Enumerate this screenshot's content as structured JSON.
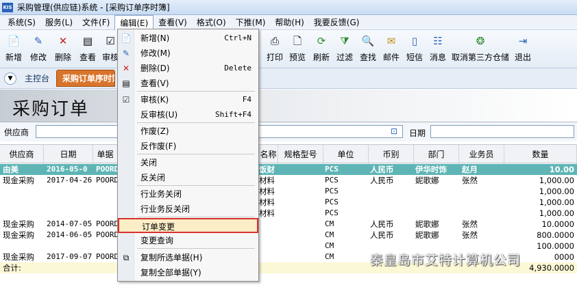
{
  "window": {
    "logo": "KIS",
    "title": "采购管理(供应链)系统 - [采购订单序时簿]"
  },
  "menu": [
    "系统(S)",
    "服务(L)",
    "文件(F)",
    "编辑(E)",
    "查看(V)",
    "格式(O)",
    "下推(M)",
    "帮助(H)",
    "我要反馈(G)"
  ],
  "toolbar": [
    {
      "label": "新增",
      "icon": "new-doc-icon"
    },
    {
      "label": "修改",
      "icon": "edit-icon"
    },
    {
      "label": "删除",
      "icon": "delete-icon"
    },
    {
      "label": "查看",
      "icon": "view-icon"
    },
    {
      "label": "审核",
      "icon": "audit-icon"
    },
    {
      "label": "打印",
      "icon": "print-icon"
    },
    {
      "label": "预览",
      "icon": "preview-icon"
    },
    {
      "label": "刷新",
      "icon": "refresh-icon"
    },
    {
      "label": "过滤",
      "icon": "filter-icon"
    },
    {
      "label": "查找",
      "icon": "find-icon"
    },
    {
      "label": "邮件",
      "icon": "mail-icon"
    },
    {
      "label": "短信",
      "icon": "sms-icon"
    },
    {
      "label": "消息",
      "icon": "message-icon"
    },
    {
      "label": "取消第三方仓储",
      "icon": "warehouse-icon"
    },
    {
      "label": "退出",
      "icon": "exit-icon"
    }
  ],
  "tabs": {
    "home": "主控台",
    "active": "采购订单序时簿"
  },
  "banner": {
    "title": "采购订单"
  },
  "filter": {
    "supplier_label": "供应商",
    "supplier_value": "",
    "date_label": "日期",
    "date_value": ""
  },
  "grid": {
    "headers": [
      "供应商",
      "日期",
      "单据",
      "名称",
      "规格型号",
      "单位",
      "币别",
      "部门",
      "业务员",
      "数量"
    ],
    "rows": [
      {
        "supplier": "由美",
        "date": "2016-05-0",
        "bill": "POORD",
        "name": "饭财",
        "unit": "PCS",
        "currency": "人民币",
        "dept": "伊华时饰",
        "clerk": "赵月",
        "qty": "10.00",
        "sel": true
      },
      {
        "supplier": "现金采购",
        "date": "2017-04-26",
        "bill": "POORD",
        "name": "材料",
        "unit": "PCS",
        "currency": "人民币",
        "dept": "妮歌娜",
        "clerk": "张然",
        "qty": "1,000.00"
      },
      {
        "supplier": "",
        "date": "",
        "bill": "",
        "name": "材料",
        "unit": "PCS",
        "currency": "",
        "dept": "",
        "clerk": "",
        "qty": "1,000.00"
      },
      {
        "supplier": "",
        "date": "",
        "bill": "",
        "name": "材料",
        "unit": "PCS",
        "currency": "",
        "dept": "",
        "clerk": "",
        "qty": "1,000.00"
      },
      {
        "supplier": "",
        "date": "",
        "bill": "",
        "name": "材料",
        "unit": "PCS",
        "currency": "",
        "dept": "",
        "clerk": "",
        "qty": "1,000.00"
      },
      {
        "supplier": "现金采购",
        "date": "2014-07-05",
        "bill": "POORD",
        "name": "",
        "unit": "CM",
        "currency": "人民币",
        "dept": "妮歌娜",
        "clerk": "张然",
        "qty": "10.0000"
      },
      {
        "supplier": "现金采购",
        "date": "2014-06-05",
        "bill": "POORD",
        "name": "",
        "unit": "CM",
        "currency": "人民币",
        "dept": "妮歌娜",
        "clerk": "张然",
        "qty": "800.0000"
      },
      {
        "supplier": "",
        "date": "",
        "bill": "",
        "name": "",
        "unit": "CM",
        "currency": "",
        "dept": "",
        "clerk": "",
        "qty": "100.0000"
      },
      {
        "supplier": "现金采购",
        "date": "2017-09-07",
        "bill": "POORD",
        "name": "",
        "unit": "CM",
        "currency": "",
        "dept": "",
        "clerk": "",
        "qty": "0000"
      }
    ],
    "total": {
      "label": "合计:",
      "qty": "4,930.0000"
    }
  },
  "edit_menu": [
    {
      "label": "新增(N)",
      "key": "Ctrl+N",
      "icon": "new-doc-icon"
    },
    {
      "label": "修改(M)",
      "key": "",
      "icon": "edit-icon"
    },
    {
      "label": "删除(D)",
      "key": "Delete",
      "icon": "delete-icon"
    },
    {
      "label": "查看(V)",
      "key": "",
      "icon": "view-icon"
    },
    {
      "label": "审核(K)",
      "key": "F4",
      "icon": "check-icon"
    },
    {
      "label": "反审核(U)",
      "key": "Shift+F4",
      "icon": ""
    },
    {
      "label": "作废(Z)",
      "key": "",
      "icon": ""
    },
    {
      "label": "反作废(F)",
      "key": "",
      "icon": ""
    },
    {
      "label": "关闭",
      "key": "",
      "icon": ""
    },
    {
      "label": "反关闭",
      "key": "",
      "icon": ""
    },
    {
      "label": "行业务关闭",
      "key": "",
      "icon": ""
    },
    {
      "label": "行业务反关闭",
      "key": "",
      "icon": ""
    },
    {
      "label": "订单变更",
      "key": "",
      "icon": ""
    },
    {
      "label": "变更查询",
      "key": "",
      "icon": ""
    },
    {
      "label": "复制所选单据(H)",
      "key": "",
      "icon": "copy-icon"
    },
    {
      "label": "复制全部单据(Y)",
      "key": "",
      "icon": ""
    }
  ],
  "watermark": "秦皇岛市艾特计算机公司",
  "colors": {
    "accent_tab": "#d9742b",
    "selected_row": "#5fb5b5",
    "highlight_border": "#d9302c"
  }
}
